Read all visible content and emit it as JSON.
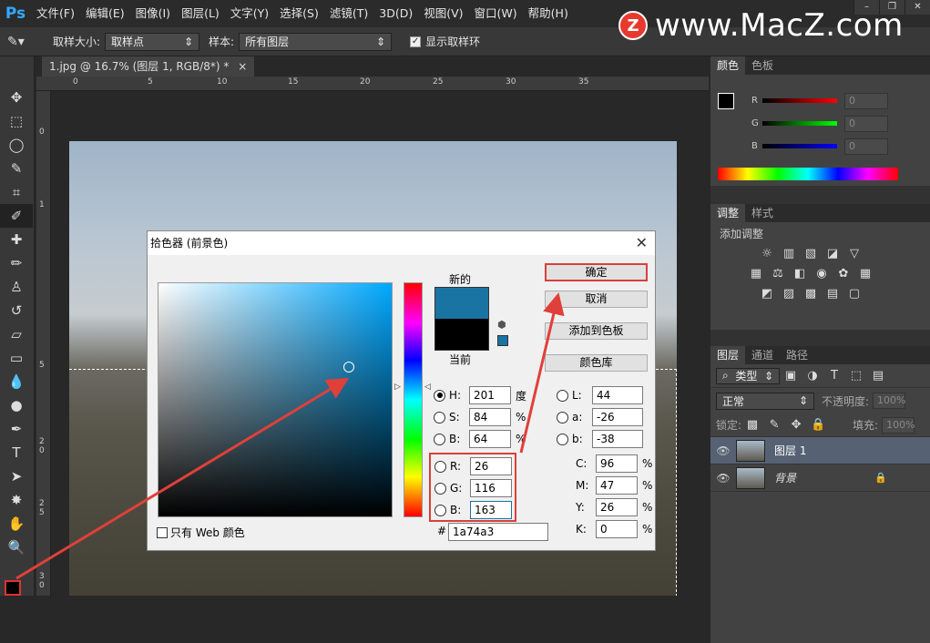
{
  "app": {
    "logo": "Ps"
  },
  "menu": [
    "文件(F)",
    "编辑(E)",
    "图像(I)",
    "图层(L)",
    "文字(Y)",
    "选择(S)",
    "滤镜(T)",
    "3D(D)",
    "视图(V)",
    "窗口(W)",
    "帮助(H)"
  ],
  "watermark": {
    "badge": "Z",
    "text": "www.MacZ.com"
  },
  "window_controls": [
    "–",
    "❐",
    "✕"
  ],
  "options": {
    "sample_size_label": "取样大小:",
    "sample_size_value": "取样点",
    "sample_label": "样本:",
    "sample_value": "所有图层",
    "show_ring_label": "显示取样环"
  },
  "document": {
    "tab": "1.jpg @ 16.7% (图层 1, RGB/8*) *",
    "close": "×"
  },
  "ruler": {
    "top_ticks": [
      "0",
      "5",
      "10",
      "15",
      "20",
      "25",
      "30",
      "35"
    ],
    "left_ticks": [
      "0",
      "1",
      "5",
      "2",
      "0",
      "2",
      "5",
      "3",
      "0"
    ]
  },
  "color_panel": {
    "tabs": [
      "颜色",
      "色板"
    ],
    "channels": [
      {
        "label": "R",
        "value": "0",
        "color": "#c00000"
      },
      {
        "label": "G",
        "value": "0",
        "color": "#00a000"
      },
      {
        "label": "B",
        "value": "0",
        "color": "#0000c0"
      }
    ]
  },
  "adjust_panel": {
    "tabs": [
      "调整",
      "样式"
    ],
    "title": "添加调整"
  },
  "layers_panel": {
    "tabs": [
      "图层",
      "通道",
      "路径"
    ],
    "filter_label": "类型",
    "blend_mode": "正常",
    "opacity_label": "不透明度:",
    "opacity_value": "100%",
    "lock_label": "锁定:",
    "fill_label": "填充:",
    "fill_value": "100%",
    "layers": [
      {
        "name": "图层 1",
        "selected": true
      },
      {
        "name": "背景",
        "locked": true
      }
    ]
  },
  "dialog": {
    "title": "拾色器 (前景色)",
    "new_label": "新的",
    "current_label": "当前",
    "new_color": "#1a74a3",
    "current_color": "#000000",
    "buttons": {
      "ok": "确定",
      "cancel": "取消",
      "add_swatch": "添加到色板",
      "library": "颜色库"
    },
    "web_only_label": "只有 Web 颜色",
    "hex_label": "#",
    "hex_value": "1a74a3",
    "hsb": [
      {
        "label": "H:",
        "value": "201",
        "unit": "度",
        "selected": true
      },
      {
        "label": "S:",
        "value": "84",
        "unit": "%"
      },
      {
        "label": "B:",
        "value": "64",
        "unit": "%"
      }
    ],
    "rgb": [
      {
        "label": "R:",
        "value": "26"
      },
      {
        "label": "G:",
        "value": "116"
      },
      {
        "label": "B:",
        "value": "163"
      }
    ],
    "lab": [
      {
        "label": "L:",
        "value": "44"
      },
      {
        "label": "a:",
        "value": "-26"
      },
      {
        "label": "b:",
        "value": "-38"
      }
    ],
    "cmyk": [
      {
        "label": "C:",
        "value": "96",
        "unit": "%"
      },
      {
        "label": "M:",
        "value": "47",
        "unit": "%"
      },
      {
        "label": "Y:",
        "value": "26",
        "unit": "%"
      },
      {
        "label": "K:",
        "value": "0",
        "unit": "%"
      }
    ]
  },
  "foreground_color": "#1a74a3"
}
